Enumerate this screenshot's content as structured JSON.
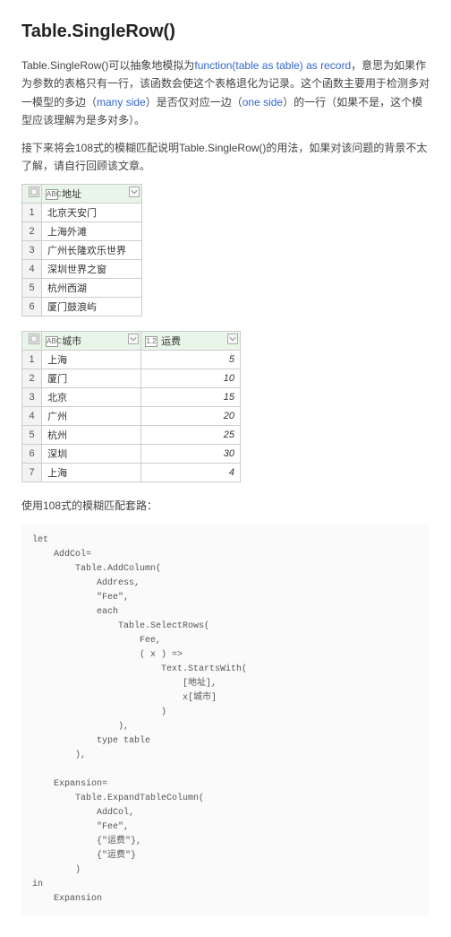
{
  "heading": "Table.SingleRow()",
  "intro": {
    "p1a": "Table.SingleRow()可以抽象地模拟为",
    "p1b": "function(table as table) as record",
    "p1c": "，意思为如果作为参数的表格只有一行，该函数会使这个表格退化为记录。这个函数主要用于检测多对一模型的多边（",
    "p1d": "many side",
    "p1e": "）是否仅对应一边（",
    "p1f": "one side",
    "p1g": "）的一行（如果不是，这个模型应该理解为是多对多）。"
  },
  "p2": "接下来将会108式的模糊匹配说明Table.SingleRow()的用法，如果对该问题的背景不太了解，请自行回顾该文章。",
  "table1": {
    "col1": {
      "type": "ABC",
      "label": "地址"
    },
    "rows": [
      {
        "n": "1",
        "v": "北京天安门"
      },
      {
        "n": "2",
        "v": "上海外滩"
      },
      {
        "n": "3",
        "v": "广州长隆欢乐世界"
      },
      {
        "n": "4",
        "v": "深圳世界之窗"
      },
      {
        "n": "5",
        "v": "杭州西湖"
      },
      {
        "n": "6",
        "v": "厦门鼓浪屿"
      }
    ]
  },
  "table2": {
    "col1": {
      "type": "ABC",
      "label": "城市"
    },
    "col2": {
      "type": "1.2",
      "label": "运费"
    },
    "rows": [
      {
        "n": "1",
        "c": "上海",
        "f": "5"
      },
      {
        "n": "2",
        "c": "厦门",
        "f": "10"
      },
      {
        "n": "3",
        "c": "北京",
        "f": "15"
      },
      {
        "n": "4",
        "c": "广州",
        "f": "20"
      },
      {
        "n": "5",
        "c": "杭州",
        "f": "25"
      },
      {
        "n": "6",
        "c": "深圳",
        "f": "30"
      },
      {
        "n": "7",
        "c": "上海",
        "f": "4"
      }
    ]
  },
  "p3": "使用108式的模糊匹配套路：",
  "code": "let\n    AddCol=\n        Table.AddColumn(\n            Address,\n            \"Fee\",\n            each\n                Table.SelectRows(\n                    Fee,\n                    ( x ) =>\n                        Text.StartsWith(\n                            [地址],\n                            x[城市]\n                        )\n                ),\n            type table\n        ),\n\n    Expansion=\n        Table.ExpandTableColumn(\n            AddCol,\n            \"Fee\",\n            {\"运费\"},\n            {\"运费\"}\n        )\nin\n    Expansion"
}
